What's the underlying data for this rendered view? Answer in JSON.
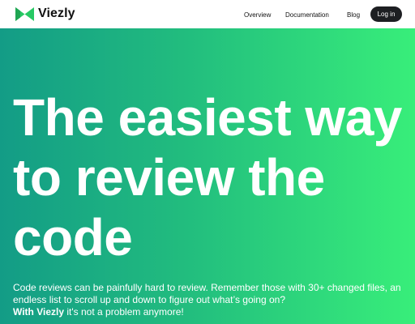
{
  "header": {
    "brand": "Viezly",
    "nav": {
      "overview": "Overview",
      "documentation": "Documentation",
      "blog": "Blog"
    },
    "login_label": "Log in"
  },
  "hero": {
    "title_lines": [
      "The easiest way",
      "to review the",
      "code"
    ],
    "description_line1": "Code reviews can be painfully hard to review. Remember those with 30+ changed files, an",
    "description_line2": "endless list to scroll up and down to figure out what’s going on?",
    "description_strong": "With Viezly",
    "description_tail": " it's not a problem anymore!"
  },
  "colors": {
    "gradient_start": "#139c86",
    "gradient_end": "#38ee7a",
    "logo_green": "#27c964",
    "button_bg": "#1d1f22"
  },
  "icons": {
    "logo": "bowtie-logo-icon"
  }
}
